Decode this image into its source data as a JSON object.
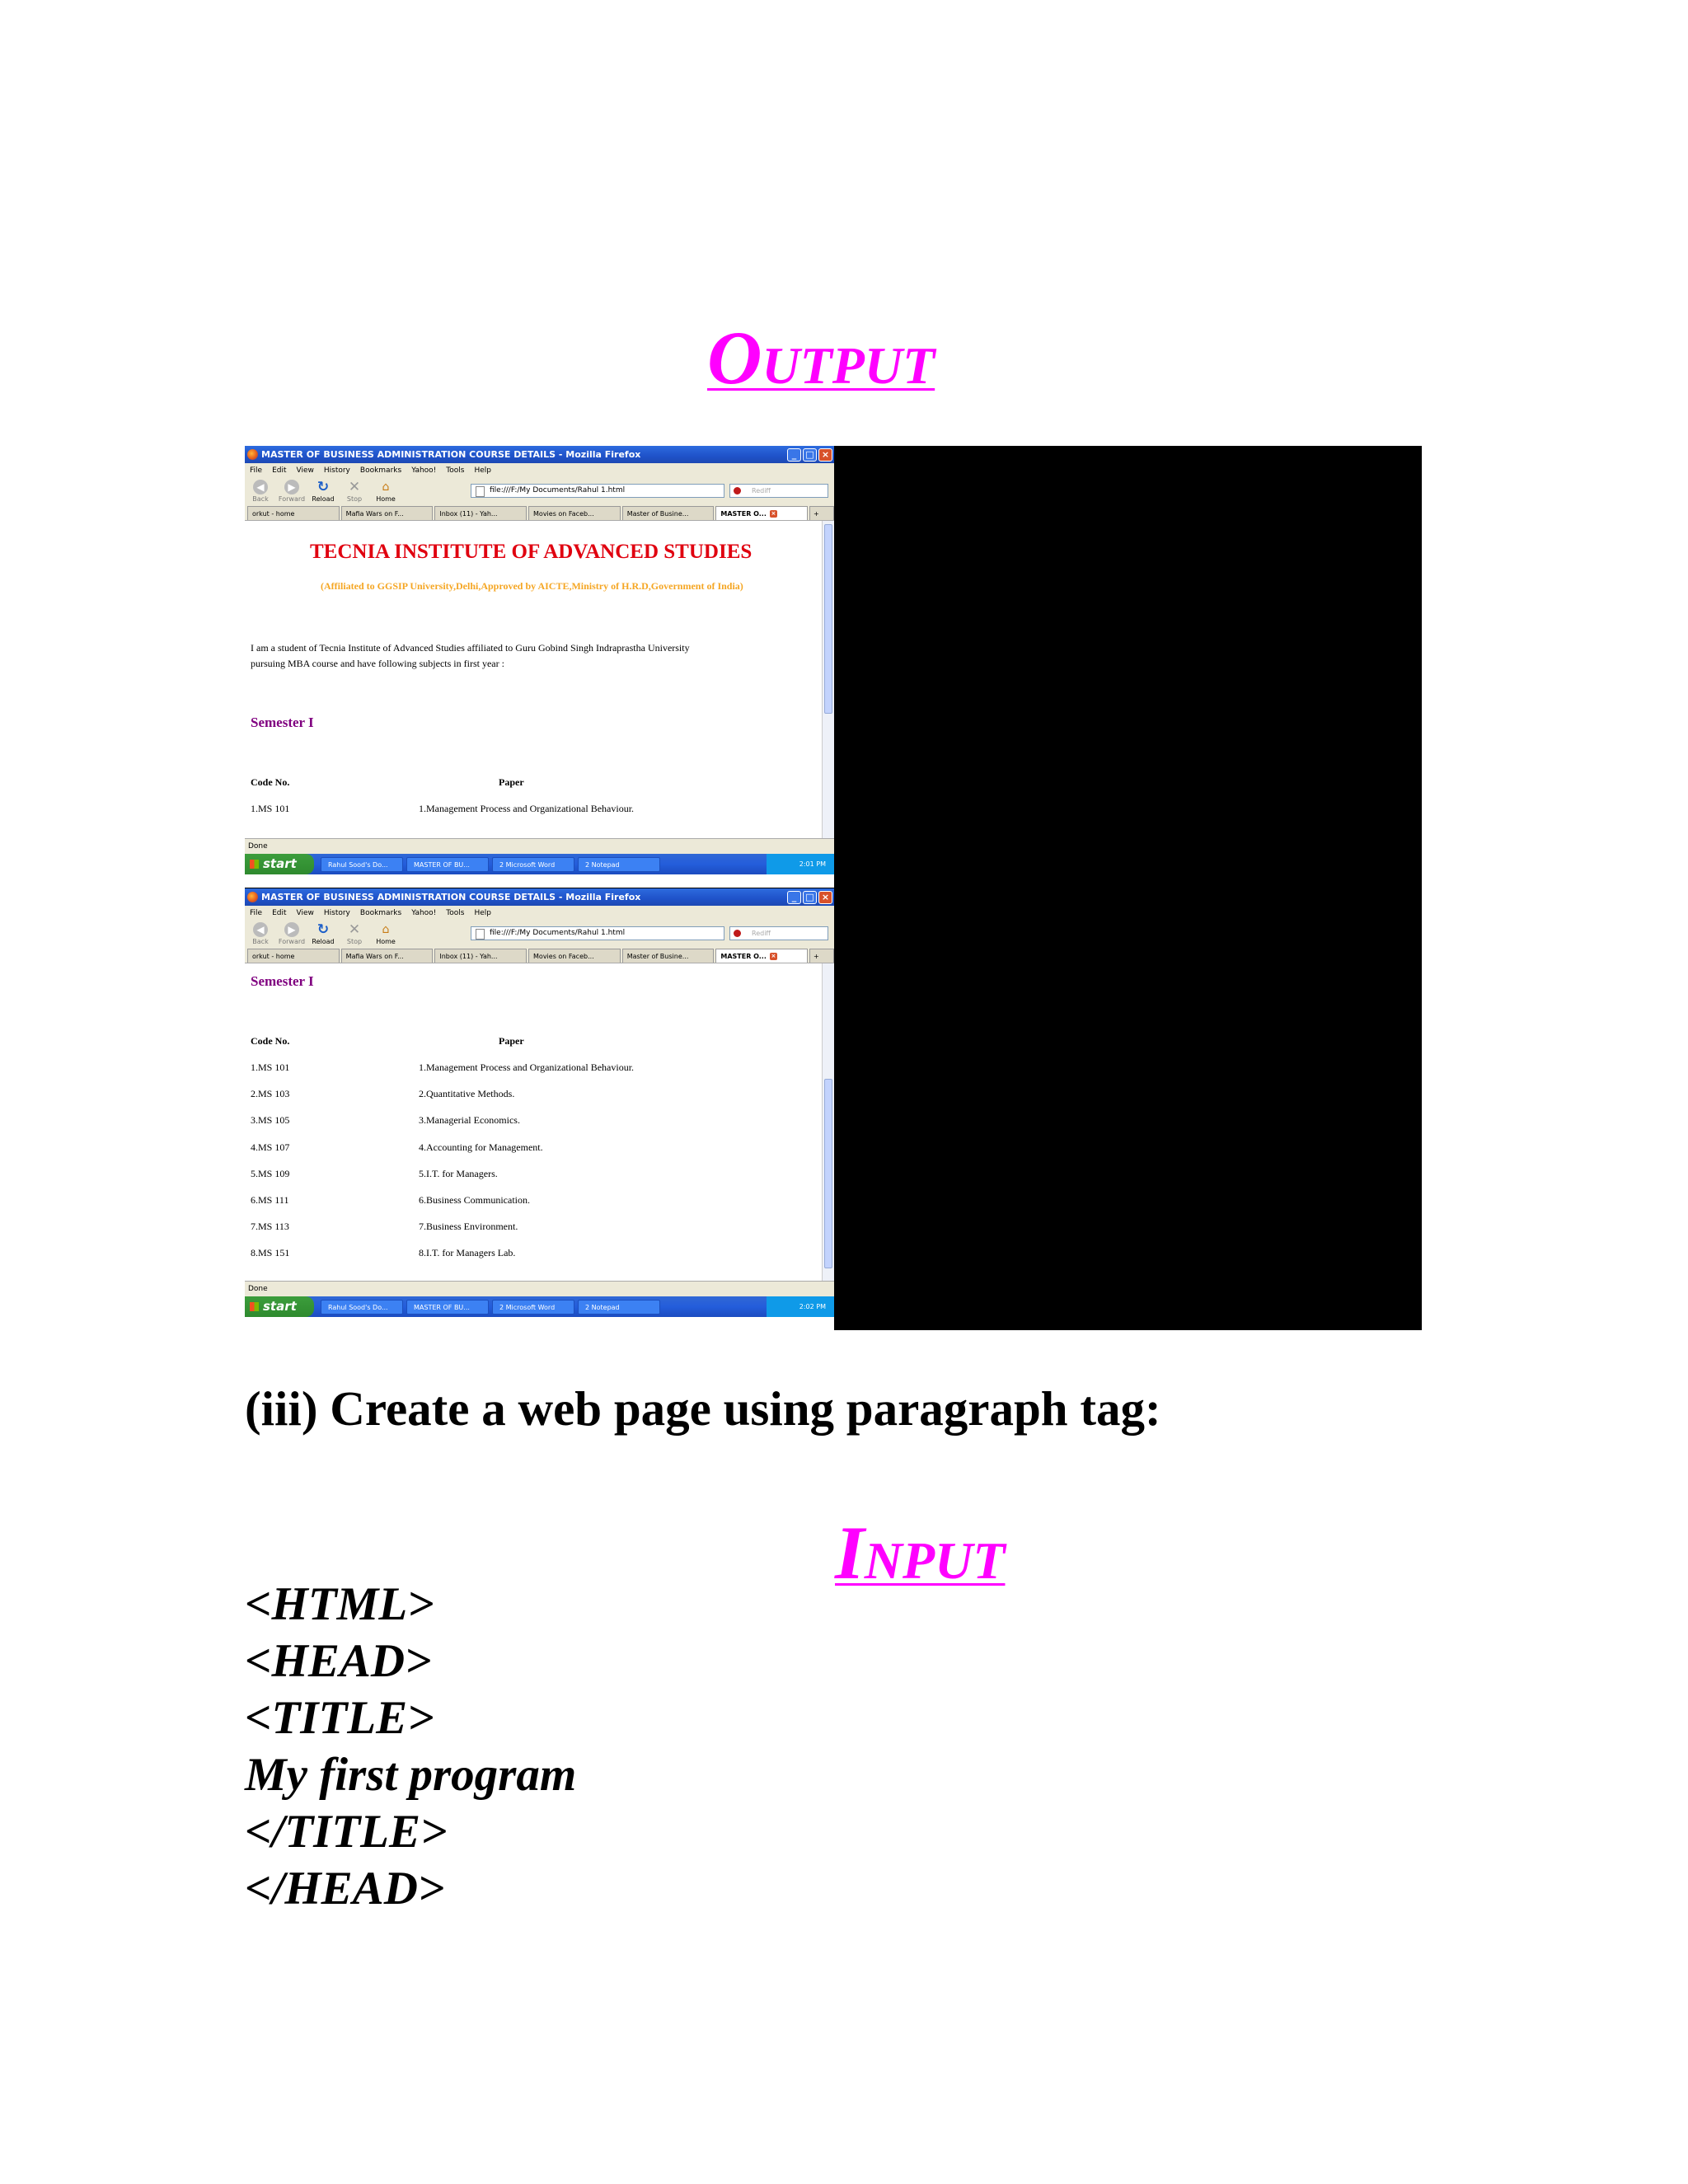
{
  "output_heading": "Output",
  "input_heading": "Input",
  "section_heading": "(iii) Create a web page using paragraph tag:",
  "code_lines": [
    "<HTML>",
    "<HEAD>",
    "<TITLE>",
    "My first program",
    "</TITLE>",
    "</HEAD>"
  ],
  "browser": {
    "window_title": "MASTER OF BUSINESS ADMINISTRATION COURSE DETAILS - Mozilla Firefox",
    "menu": [
      "File",
      "Edit",
      "View",
      "History",
      "Bookmarks",
      "Yahoo!",
      "Tools",
      "Help"
    ],
    "nav": {
      "back": "Back",
      "forward": "Forward",
      "reload": "Reload",
      "stop": "Stop",
      "home": "Home"
    },
    "url": "file:///F:/My Documents/Rahul 1.html",
    "search_placeholder": "Rediff",
    "tabs": [
      "orkut - home",
      "Mafia Wars on F...",
      "Inbox (11) - Yah...",
      "Movies on Faceb...",
      "Master of Busine...",
      "MASTER O..."
    ],
    "status": "Done",
    "taskbar": {
      "start": "start",
      "items": [
        "Rahul Sood's Do...",
        "MASTER OF BU...",
        "2 Microsoft Word",
        "2 Notepad"
      ],
      "time_1": "2:01 PM",
      "time_2": "2:02 PM"
    }
  },
  "page": {
    "institute": "TECNIA INSTITUTE OF ADVANCED STUDIES",
    "affiliation": "(Affiliated to GGSIP University,Delhi,Approved by AICTE,Ministry of H.R.D,Government of India)",
    "intro_line1": "I am a student of Tecnia Institute of Advanced Studies affiliated to Guru Gobind Singh Indraprastha University",
    "intro_line2": "pursuing MBA course and have following subjects in first year :",
    "semester": "Semester I",
    "col_code": "Code No.",
    "col_paper": "Paper",
    "rows": [
      {
        "code": "1.MS 101",
        "paper": "1.Management Process and Organizational Behaviour."
      },
      {
        "code": "2.MS 103",
        "paper": "2.Quantitative Methods."
      },
      {
        "code": "3.MS 105",
        "paper": "3.Managerial Economics."
      },
      {
        "code": "4.MS 107",
        "paper": "4.Accounting for Management."
      },
      {
        "code": "5.MS 109",
        "paper": "5.I.T. for Managers."
      },
      {
        "code": "6.MS 111",
        "paper": "6.Business Communication."
      },
      {
        "code": "7.MS 113",
        "paper": "7.Business Environment."
      },
      {
        "code": "8.MS 151",
        "paper": "8.I.T. for Managers Lab."
      }
    ]
  },
  "colors": {
    "heading": "#ff00ff",
    "institute": "#e0000f",
    "affiliation": "#f5a623",
    "semester": "#800080"
  }
}
